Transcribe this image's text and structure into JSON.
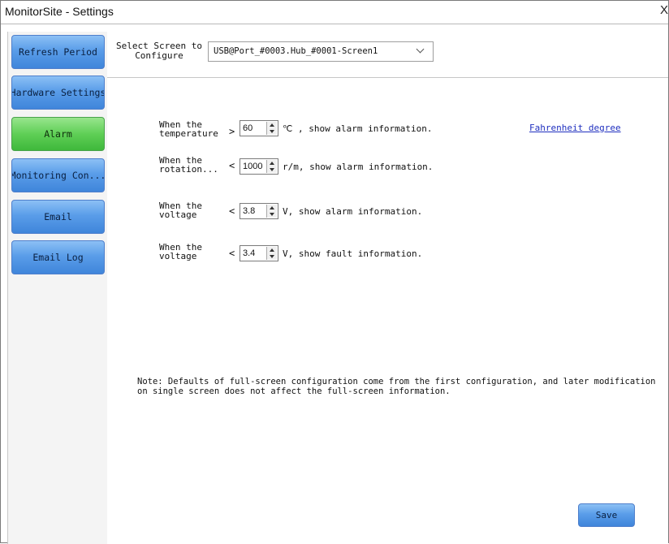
{
  "window": {
    "title": "MonitorSite - Settings",
    "close_label": "X"
  },
  "sidebar": {
    "items": [
      {
        "label": "Refresh Period",
        "active": false
      },
      {
        "label": "Hardware Settings",
        "active": false
      },
      {
        "label": "Alarm",
        "active": true
      },
      {
        "label": "Monitoring Con...",
        "active": false
      },
      {
        "label": "Email",
        "active": false
      },
      {
        "label": "Email Log",
        "active": false
      }
    ]
  },
  "screen_select": {
    "label": "Select Screen to Configure",
    "value": "USB@Port_#0003.Hub_#0001-Screen1"
  },
  "alarms": [
    {
      "label": "When the\ntemperature",
      "operator": ">",
      "value": "60",
      "message": "℃ , show alarm information."
    },
    {
      "label": "When the\nrotation...",
      "operator": "<",
      "value": "1000",
      "message": "r/m, show alarm information."
    },
    {
      "label": "When the\nvoltage",
      "operator": "<",
      "value": "3.8",
      "message": "V, show alarm information."
    },
    {
      "label": "When the\nvoltage",
      "operator": "<",
      "value": "3.4",
      "message": "V, show fault information."
    }
  ],
  "fahrenheit_link": "Fahrenheit degree",
  "note": "Note: Defaults of full-screen configuration come from the first configuration, and later modification on single screen does not affect the full-screen information.",
  "save_label": "Save",
  "colors": {
    "nav_blue": "#5a9de9",
    "nav_active_green": "#5fcf56",
    "link_blue": "#1f2fbf"
  }
}
